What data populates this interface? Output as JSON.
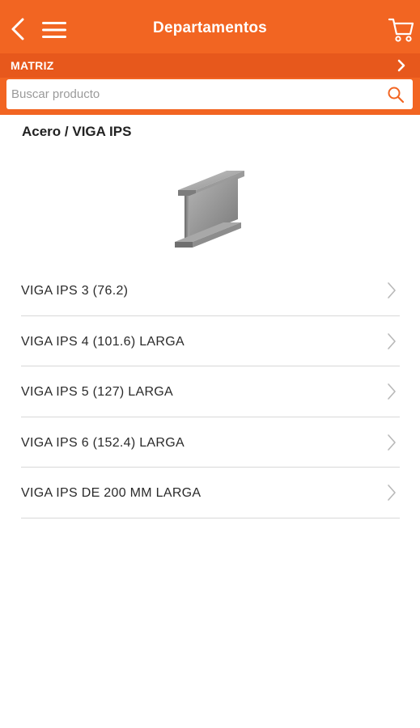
{
  "header": {
    "title": "Departamentos",
    "back_icon": "chevron-left-icon",
    "menu_icon": "hamburger-menu-icon",
    "cart_icon": "shopping-cart-icon",
    "color": "#f26522"
  },
  "branch": {
    "label": "MATRIZ",
    "chevron_icon": "chevron-right-icon"
  },
  "search": {
    "placeholder": "Buscar producto",
    "value": "",
    "icon": "search-icon"
  },
  "breadcrumb": "Acero / VIGA IPS",
  "product_image": "steel-i-beam",
  "items": [
    {
      "label": "VIGA IPS 3 (76.2)"
    },
    {
      "label": "VIGA IPS 4 (101.6) LARGA"
    },
    {
      "label": "VIGA IPS 5 (127) LARGA"
    },
    {
      "label": "VIGA IPS 6 (152.4) LARGA"
    },
    {
      "label": "VIGA IPS DE 200 MM LARGA"
    }
  ]
}
